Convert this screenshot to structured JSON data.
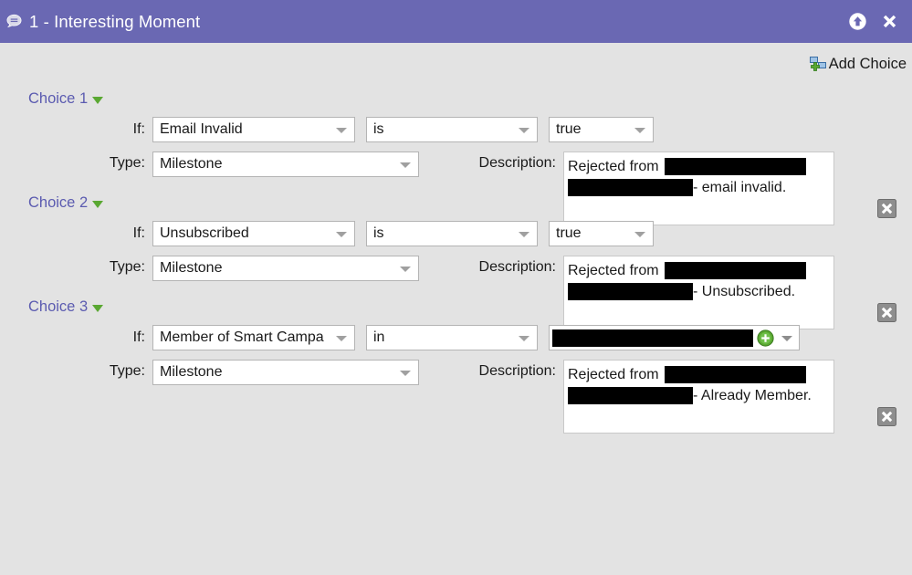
{
  "window": {
    "title": "1 - Interesting Moment",
    "title_icon": "speech-bubble-icon",
    "header_color": "#6a68b3",
    "background_color": "#e3e3e3",
    "buttons": {
      "collapse_label": "collapse-up-icon",
      "close_label": "close-icon"
    }
  },
  "toolbar": {
    "add_choice_label": "Add Choice",
    "add_choice_icon": "add-node-icon"
  },
  "labels": {
    "if": "If:",
    "type": "Type:",
    "description": "Description:"
  },
  "accent": {
    "choice_title_color": "#5b5bb0",
    "triangle_color": "#5aa832",
    "plus_color": "#5aa832"
  },
  "choices": [
    {
      "title": "Choice 1",
      "condition_field": "Email Invalid",
      "operator": "is",
      "value": "true",
      "type": "Milestone",
      "description_line1_prefix": "Rejected from",
      "description_line1_redacted": true,
      "description_line2_redacted": true,
      "description_line2_suffix": "- email invalid.",
      "has_value_combo": false
    },
    {
      "title": "Choice 2",
      "condition_field": "Unsubscribed",
      "operator": "is",
      "value": "true",
      "type": "Milestone",
      "description_line1_prefix": "Rejected from",
      "description_line1_redacted": true,
      "description_line2_redacted": true,
      "description_line2_suffix": "- Unsubscribed.",
      "has_value_combo": false
    },
    {
      "title": "Choice 3",
      "condition_field": "Member of Smart Campa",
      "operator": "in",
      "value": "",
      "type": "Milestone",
      "description_line1_prefix": "Rejected from",
      "description_line1_redacted": true,
      "description_line2_redacted": true,
      "description_line2_suffix": "- Already Member.",
      "has_value_combo": true
    }
  ]
}
